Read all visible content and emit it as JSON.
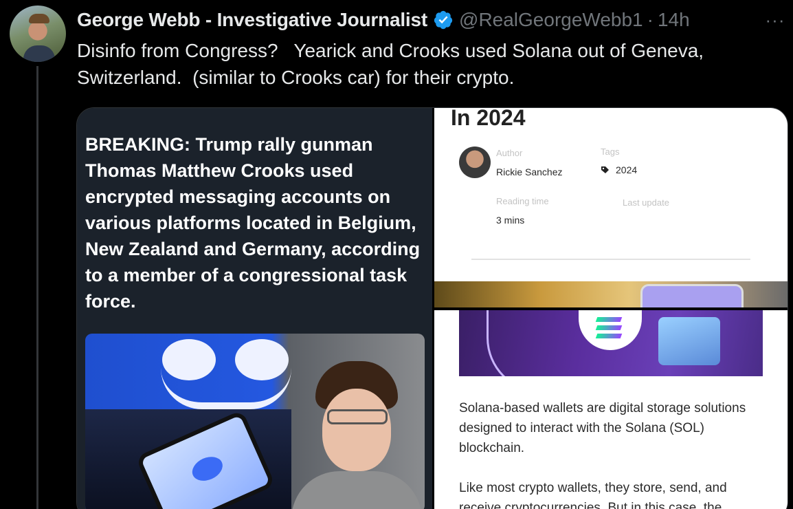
{
  "tweet": {
    "author_name": "George Webb - Investigative Journalist",
    "handle": "@RealGeorgeWebb1",
    "separator": "·",
    "timestamp": "14h",
    "more_label": "···",
    "text": "Disinfo from Congress?   Yearick and Crooks used Solana out of Geneva, Switzerland.  (similar to Crooks car) for their crypto."
  },
  "media": {
    "left": {
      "headline": "BREAKING: Trump rally gunman Thomas Matthew Crooks used encrypted messaging accounts on various platforms located in Belgium, New Zealand and Germany, according to a member of a congressional task force."
    },
    "right_top": {
      "heading": "In 2024",
      "author_label": "Author",
      "author_value": "Rickie Sanchez",
      "tags_label": "Tags",
      "tags_value": "2024",
      "reading_label": "Reading time",
      "reading_value": "3 mins",
      "update_label": "Last update"
    },
    "right_bottom": {
      "paragraph1": "Solana-based wallets are digital storage solutions designed to interact with the Solana (SOL) blockchain.",
      "paragraph2": "Like most crypto wallets, they store, send, and receive cryptocurrencies. But in this case, the"
    }
  },
  "colors": {
    "background": "#000000",
    "verified": "#1d9bf0",
    "muted": "#71767b",
    "card_left": "#1b222b"
  }
}
